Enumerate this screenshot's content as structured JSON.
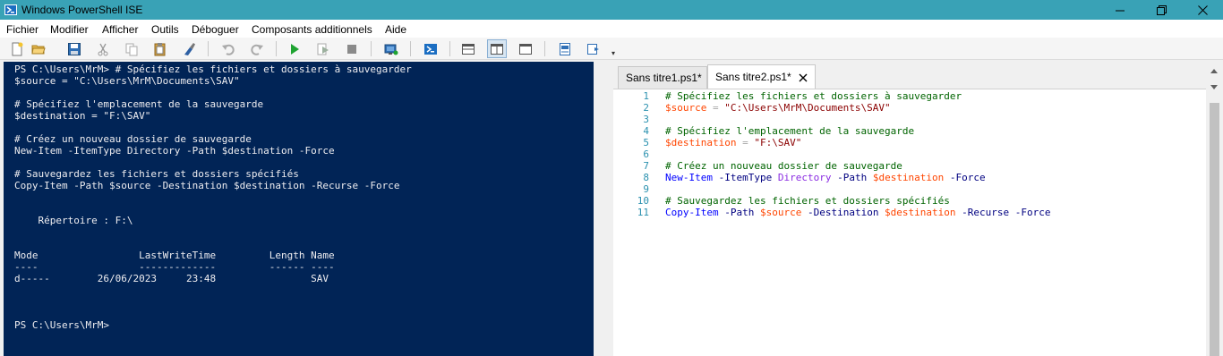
{
  "window": {
    "title": "Windows PowerShell ISE",
    "accent_color": "#39a2b6"
  },
  "menu": [
    "Fichier",
    "Modifier",
    "Afficher",
    "Outils",
    "Déboguer",
    "Composants additionnels",
    "Aide"
  ],
  "toolbar": {
    "buttons": [
      "new-script-icon",
      "open-icon",
      "save-icon",
      "cut-icon",
      "copy-icon",
      "paste-icon",
      "clear-console-icon",
      "undo-icon",
      "redo-icon",
      "run-script-icon",
      "run-selection-icon",
      "stop-icon",
      "new-remote-tab-icon",
      "start-powershell-icon",
      "show-script-top-icon",
      "show-script-right-icon",
      "show-script-maximized-icon",
      "show-command-icon",
      "show-addon-icon"
    ]
  },
  "console": {
    "background": "#012456",
    "lines": [
      "PS C:\\Users\\MrM> # Spécifiez les fichiers et dossiers à sauvegarder",
      "$source = \"C:\\Users\\MrM\\Documents\\SAV\"",
      "",
      "# Spécifiez l'emplacement de la sauvegarde",
      "$destination = \"F:\\SAV\"",
      "",
      "# Créez un nouveau dossier de sauvegarde",
      "New-Item -ItemType Directory -Path $destination -Force",
      "",
      "# Sauvegardez les fichiers et dossiers spécifiés",
      "Copy-Item -Path $source -Destination $destination -Recurse -Force",
      "",
      "",
      "    Répertoire : F:\\",
      "",
      "",
      "Mode                 LastWriteTime         Length Name",
      "----                 -------------         ------ ----",
      "d-----        26/06/2023     23:48                SAV",
      "",
      "",
      "",
      "PS C:\\Users\\MrM>"
    ]
  },
  "tabs": [
    {
      "label": "Sans titre1.ps1*"
    },
    {
      "label": "Sans titre2.ps1*"
    }
  ],
  "editor": {
    "line_numbers": [
      "1",
      "2",
      "3",
      "4",
      "5",
      "6",
      "7",
      "8",
      "9",
      "10",
      "11"
    ],
    "lines": [
      [
        {
          "t": "# Spécifiez les fichiers et dossiers à sauvegarder",
          "k": "comment"
        }
      ],
      [
        {
          "t": "$source",
          "k": "var"
        },
        {
          "t": " = ",
          "k": "op"
        },
        {
          "t": "\"C:\\Users\\MrM\\Documents\\SAV\"",
          "k": "str"
        }
      ],
      [],
      [
        {
          "t": "# Spécifiez l'emplacement de la sauvegarde",
          "k": "comment"
        }
      ],
      [
        {
          "t": "$destination",
          "k": "var"
        },
        {
          "t": " = ",
          "k": "op"
        },
        {
          "t": "\"F:\\SAV\"",
          "k": "str"
        }
      ],
      [],
      [
        {
          "t": "# Créez un nouveau dossier de sauvegarde",
          "k": "comment"
        }
      ],
      [
        {
          "t": "New-Item",
          "k": "cmd"
        },
        {
          "t": " -ItemType",
          "k": "param"
        },
        {
          "t": " Directory",
          "k": "type"
        },
        {
          "t": " -Path",
          "k": "param"
        },
        {
          "t": " $destination",
          "k": "var"
        },
        {
          "t": " -Force",
          "k": "param"
        }
      ],
      [],
      [
        {
          "t": "# Sauvegardez les fichiers et dossiers spécifiés",
          "k": "comment"
        }
      ],
      [
        {
          "t": "Copy-Item",
          "k": "cmd"
        },
        {
          "t": " -Path",
          "k": "param"
        },
        {
          "t": " $source",
          "k": "var"
        },
        {
          "t": " -Destination",
          "k": "param"
        },
        {
          "t": " $destination",
          "k": "var"
        },
        {
          "t": " -Recurse",
          "k": "param"
        },
        {
          "t": " -Force",
          "k": "param"
        }
      ]
    ]
  }
}
